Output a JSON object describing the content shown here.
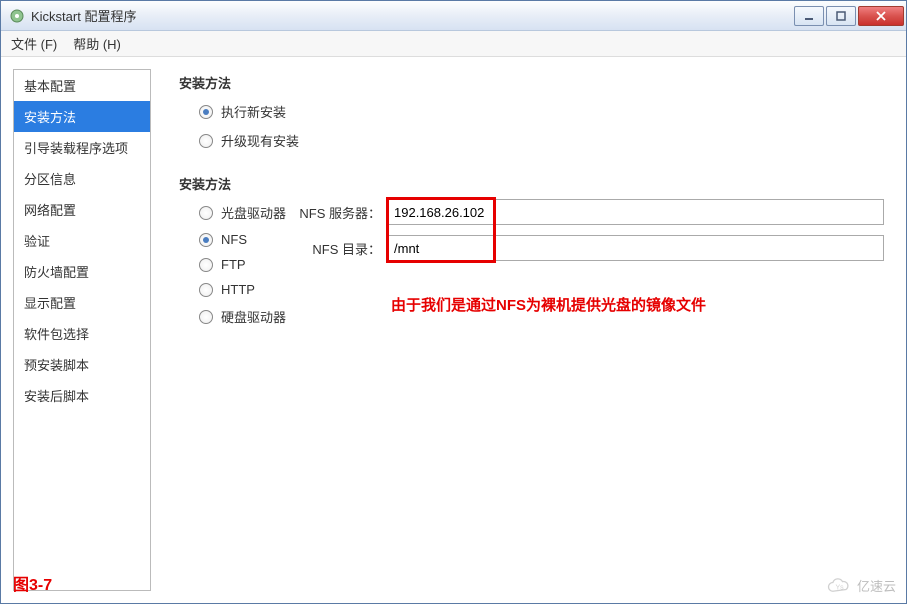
{
  "window": {
    "title": "Kickstart 配置程序"
  },
  "menubar": {
    "file": "文件 (F)",
    "help": "帮助 (H)"
  },
  "sidebar": {
    "items": [
      {
        "label": "基本配置"
      },
      {
        "label": "安装方法"
      },
      {
        "label": "引导装载程序选项"
      },
      {
        "label": "分区信息"
      },
      {
        "label": "网络配置"
      },
      {
        "label": "验证"
      },
      {
        "label": "防火墙配置"
      },
      {
        "label": "显示配置"
      },
      {
        "label": "软件包选择"
      },
      {
        "label": "预安装脚本"
      },
      {
        "label": "安装后脚本"
      }
    ],
    "selected_index": 1
  },
  "main": {
    "section1_title": "安装方法",
    "install_type": {
      "new": "执行新安装",
      "upgrade": "升级现有安装"
    },
    "section2_title": "安装方法",
    "media": {
      "cdrom": "光盘驱动器",
      "nfs": "NFS",
      "ftp": "FTP",
      "http": "HTTP",
      "hdd": "硬盘驱动器"
    },
    "form": {
      "nfs_server_label": "NFS 服务器：",
      "nfs_server_value": "192.168.26.102",
      "nfs_dir_label": "NFS 目录：",
      "nfs_dir_value": "/mnt"
    }
  },
  "annotation": "由于我们是通过NFS为裸机提供光盘的镜像文件",
  "figure_label": "图3-7",
  "watermark": "亿速云"
}
